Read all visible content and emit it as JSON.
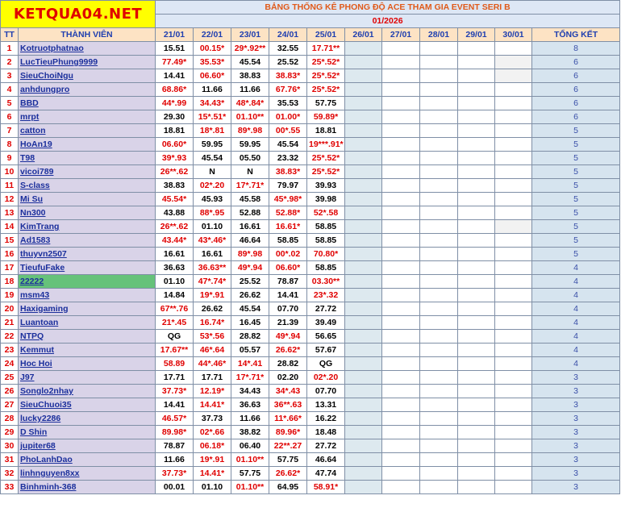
{
  "logo": "KETQUA04.NET",
  "banner": "BẢNG THỐNG KÊ PHONG ĐỘ ACE THAM GIA EVENT SERI B",
  "month": "01/2026",
  "headers": {
    "tt": "TT",
    "member": "THÀNH VIÊN",
    "dates": [
      "21/01",
      "22/01",
      "23/01",
      "24/01",
      "25/01",
      "26/01",
      "27/01",
      "28/01",
      "29/01",
      "30/01"
    ],
    "total": "TỔNG KẾT"
  },
  "colors": {
    "red_text": "#e00000",
    "name_text": "#1b2f9c",
    "highlight_row": "#66c27a",
    "logo_bg": "#ffff00"
  },
  "rows": [
    {
      "tt": "1",
      "name": "Kotruotphatnao",
      "cells": [
        [
          "15.51",
          0
        ],
        [
          "00.15*",
          1
        ],
        [
          "29*.92**",
          1
        ],
        [
          "32.55",
          0
        ],
        [
          "17.71**",
          1
        ]
      ],
      "total": "8"
    },
    {
      "tt": "2",
      "name": "LucTieuPhung9999",
      "cells": [
        [
          "77.49*",
          1
        ],
        [
          "35.53*",
          1
        ],
        [
          "45.54",
          0
        ],
        [
          "25.52",
          0
        ],
        [
          "25*.52*",
          1
        ]
      ],
      "total": "6"
    },
    {
      "tt": "3",
      "name": "SieuChoiNgu",
      "cells": [
        [
          "14.41",
          0
        ],
        [
          "06.60*",
          1
        ],
        [
          "38.83",
          0
        ],
        [
          "38.83*",
          1
        ],
        [
          "25*.52*",
          1
        ]
      ],
      "total": "6"
    },
    {
      "tt": "4",
      "name": "anhdungpro",
      "cells": [
        [
          "68.86*",
          1
        ],
        [
          "11.66",
          0
        ],
        [
          "11.66",
          0
        ],
        [
          "67.76*",
          1
        ],
        [
          "25*.52*",
          1
        ]
      ],
      "total": "6"
    },
    {
      "tt": "5",
      "name": "BBD",
      "cells": [
        [
          "44*.99",
          1
        ],
        [
          "34.43*",
          1
        ],
        [
          "48*.84*",
          1
        ],
        [
          "35.53",
          0
        ],
        [
          "57.75",
          0
        ]
      ],
      "total": "6"
    },
    {
      "tt": "6",
      "name": "mrpt",
      "cells": [
        [
          "29.30",
          0
        ],
        [
          "15*.51*",
          1
        ],
        [
          "01.10**",
          1
        ],
        [
          "01.00*",
          1
        ],
        [
          "59.89*",
          1
        ]
      ],
      "total": "6"
    },
    {
      "tt": "7",
      "name": "catton",
      "cells": [
        [
          "18.81",
          0
        ],
        [
          "18*.81",
          1
        ],
        [
          "89*.98",
          1
        ],
        [
          "00*.55",
          1
        ],
        [
          "18.81",
          0
        ]
      ],
      "total": "5"
    },
    {
      "tt": "8",
      "name": "HoAn19",
      "cells": [
        [
          "06.60*",
          1
        ],
        [
          "59.95",
          0
        ],
        [
          "59.95",
          0
        ],
        [
          "45.54",
          0
        ],
        [
          "19***.91*",
          1
        ]
      ],
      "total": "5"
    },
    {
      "tt": "9",
      "name": "T98",
      "cells": [
        [
          "39*.93",
          1
        ],
        [
          "45.54",
          0
        ],
        [
          "05.50",
          0
        ],
        [
          "23.32",
          0
        ],
        [
          "25*.52*",
          1
        ]
      ],
      "total": "5"
    },
    {
      "tt": "10",
      "name": "vicoi789",
      "cells": [
        [
          "26**.62",
          1
        ],
        [
          "N",
          0
        ],
        [
          "N",
          0
        ],
        [
          "38.83*",
          1
        ],
        [
          "25*.52*",
          1
        ]
      ],
      "total": "5"
    },
    {
      "tt": "11",
      "name": "S-class",
      "cells": [
        [
          "38.83",
          0
        ],
        [
          "02*.20",
          1
        ],
        [
          "17*.71*",
          1
        ],
        [
          "79.97",
          0
        ],
        [
          "39.93",
          0
        ]
      ],
      "total": "5"
    },
    {
      "tt": "12",
      "name": "Mi Su",
      "cells": [
        [
          "45.54*",
          1
        ],
        [
          "45.93",
          0
        ],
        [
          "45.58",
          0
        ],
        [
          "45*.98*",
          1
        ],
        [
          "39.98",
          0
        ]
      ],
      "total": "5"
    },
    {
      "tt": "13",
      "name": "Nn300",
      "cells": [
        [
          "43.88",
          0
        ],
        [
          "88*.95",
          1
        ],
        [
          "52.88",
          0
        ],
        [
          "52.88*",
          1
        ],
        [
          "52*.58",
          1
        ]
      ],
      "total": "5"
    },
    {
      "tt": "14",
      "name": "KimTrang",
      "cells": [
        [
          "26**.62",
          1
        ],
        [
          "01.10",
          0
        ],
        [
          "16.61",
          0
        ],
        [
          "16.61*",
          1
        ],
        [
          "58.85",
          0
        ]
      ],
      "total": "5"
    },
    {
      "tt": "15",
      "name": "Ad1583",
      "cells": [
        [
          "43.44*",
          1
        ],
        [
          "43*.46*",
          1
        ],
        [
          "46.64",
          0
        ],
        [
          "58.85",
          0
        ],
        [
          "58.85",
          0
        ]
      ],
      "total": "5"
    },
    {
      "tt": "16",
      "name": "thuyvn2507",
      "cells": [
        [
          "16.61",
          0
        ],
        [
          "16.61",
          0
        ],
        [
          "89*.98",
          1
        ],
        [
          "00*.02",
          1
        ],
        [
          "70.80*",
          1
        ]
      ],
      "total": "5"
    },
    {
      "tt": "17",
      "name": "TieufuFake",
      "cells": [
        [
          "36.63",
          0
        ],
        [
          "36.63**",
          1
        ],
        [
          "49*.94",
          1
        ],
        [
          "06.60*",
          1
        ],
        [
          "58.85",
          0
        ]
      ],
      "total": "4"
    },
    {
      "tt": "18",
      "name": "22222",
      "cells": [
        [
          "01.10",
          0
        ],
        [
          "47*.74*",
          1
        ],
        [
          "25.52",
          0
        ],
        [
          "78.87",
          0
        ],
        [
          "03.30**",
          1
        ]
      ],
      "total": "4"
    },
    {
      "tt": "19",
      "name": "msm43",
      "cells": [
        [
          "14.84",
          0
        ],
        [
          "19*.91",
          1
        ],
        [
          "26.62",
          0
        ],
        [
          "14.41",
          0
        ],
        [
          "23*.32",
          1
        ]
      ],
      "total": "4"
    },
    {
      "tt": "20",
      "name": "Haxigaming",
      "cells": [
        [
          "67**.76",
          1
        ],
        [
          "26.62",
          0
        ],
        [
          "45.54",
          0
        ],
        [
          "07.70",
          0
        ],
        [
          "27.72",
          0
        ]
      ],
      "total": "4"
    },
    {
      "tt": "21",
      "name": "Luantoan",
      "cells": [
        [
          "21*.45",
          1
        ],
        [
          "16.74*",
          1
        ],
        [
          "16.45",
          0
        ],
        [
          "21.39",
          0
        ],
        [
          "39.49",
          0
        ]
      ],
      "total": "4"
    },
    {
      "tt": "22",
      "name": "NTPQ",
      "cells": [
        [
          "QG",
          0
        ],
        [
          "53*.56",
          1
        ],
        [
          "28.82",
          0
        ],
        [
          "49*.94",
          1
        ],
        [
          "56.65",
          0
        ]
      ],
      "total": "4"
    },
    {
      "tt": "23",
      "name": "Kemmut",
      "cells": [
        [
          "17.67**",
          1
        ],
        [
          "46*.64",
          1
        ],
        [
          "05.57",
          0
        ],
        [
          "26.62*",
          1
        ],
        [
          "57.67",
          0
        ]
      ],
      "total": "4"
    },
    {
      "tt": "24",
      "name": "Hoc Hoi",
      "cells": [
        [
          "58.89",
          1
        ],
        [
          "44*.46*",
          1
        ],
        [
          "14*.41",
          1
        ],
        [
          "28.82",
          0
        ],
        [
          "QG",
          0
        ]
      ],
      "total": "4"
    },
    {
      "tt": "25",
      "name": "J97",
      "cells": [
        [
          "17.71",
          0
        ],
        [
          "17.71",
          0
        ],
        [
          "17*.71*",
          1
        ],
        [
          "02.20",
          0
        ],
        [
          "02*.20",
          1
        ]
      ],
      "total": "3"
    },
    {
      "tt": "26",
      "name": "Songlo2nhay",
      "cells": [
        [
          "37.73*",
          1
        ],
        [
          "12.19*",
          1
        ],
        [
          "34.43",
          0
        ],
        [
          "34*.43",
          1
        ],
        [
          "07.70",
          0
        ]
      ],
      "total": "3"
    },
    {
      "tt": "27",
      "name": "SieuChuoi35",
      "cells": [
        [
          "14.41",
          0
        ],
        [
          "14.41*",
          1
        ],
        [
          "36.63",
          0
        ],
        [
          "36**.63",
          1
        ],
        [
          "13.31",
          0
        ]
      ],
      "total": "3"
    },
    {
      "tt": "28",
      "name": "lucky2286",
      "cells": [
        [
          "46.57*",
          1
        ],
        [
          "37.73",
          0
        ],
        [
          "11.66",
          0
        ],
        [
          "11*.66*",
          1
        ],
        [
          "16.22",
          0
        ]
      ],
      "total": "3"
    },
    {
      "tt": "29",
      "name": "D Shin",
      "cells": [
        [
          "89.98*",
          1
        ],
        [
          "02*.66",
          1
        ],
        [
          "38.82",
          0
        ],
        [
          "89.96*",
          1
        ],
        [
          "18.48",
          0
        ]
      ],
      "total": "3"
    },
    {
      "tt": "30",
      "name": "jupiter68",
      "cells": [
        [
          "78.87",
          0
        ],
        [
          "06.18*",
          1
        ],
        [
          "06.40",
          0
        ],
        [
          "22**.27",
          1
        ],
        [
          "27.72",
          0
        ]
      ],
      "total": "3"
    },
    {
      "tt": "31",
      "name": "PhoLanhDao",
      "cells": [
        [
          "11.66",
          0
        ],
        [
          "19*.91",
          1
        ],
        [
          "01.10**",
          1
        ],
        [
          "57.75",
          0
        ],
        [
          "46.64",
          0
        ]
      ],
      "total": "3"
    },
    {
      "tt": "32",
      "name": "linhnguyen8xx",
      "cells": [
        [
          "37.73*",
          1
        ],
        [
          "14.41*",
          1
        ],
        [
          "57.75",
          0
        ],
        [
          "26.62*",
          1
        ],
        [
          "47.74",
          0
        ]
      ],
      "total": "3"
    },
    {
      "tt": "33",
      "name": "Binhminh-368",
      "cells": [
        [
          "00.01",
          0
        ],
        [
          "01.10",
          0
        ],
        [
          "01.10**",
          1
        ],
        [
          "64.95",
          0
        ],
        [
          "58.91*",
          1
        ]
      ],
      "total": "3"
    }
  ]
}
